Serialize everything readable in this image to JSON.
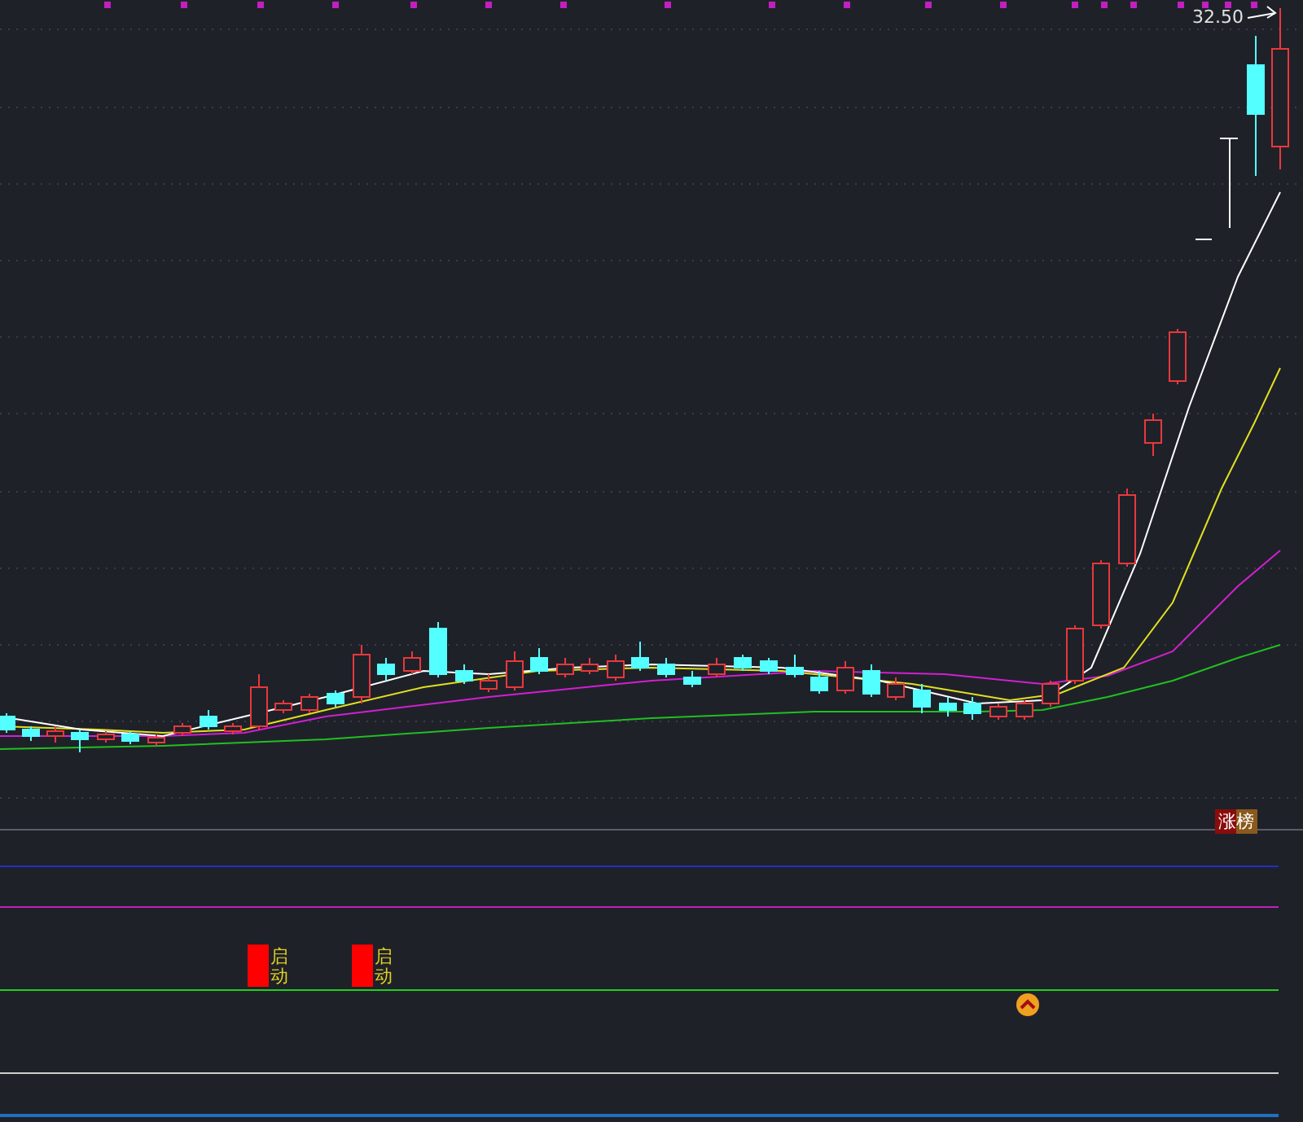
{
  "price_panel": {
    "high_price_label": "32.50",
    "badge": "涨榜"
  },
  "indicator_panel": {
    "signals": [
      {
        "label": "启动"
      },
      {
        "label": "启动"
      }
    ]
  }
}
